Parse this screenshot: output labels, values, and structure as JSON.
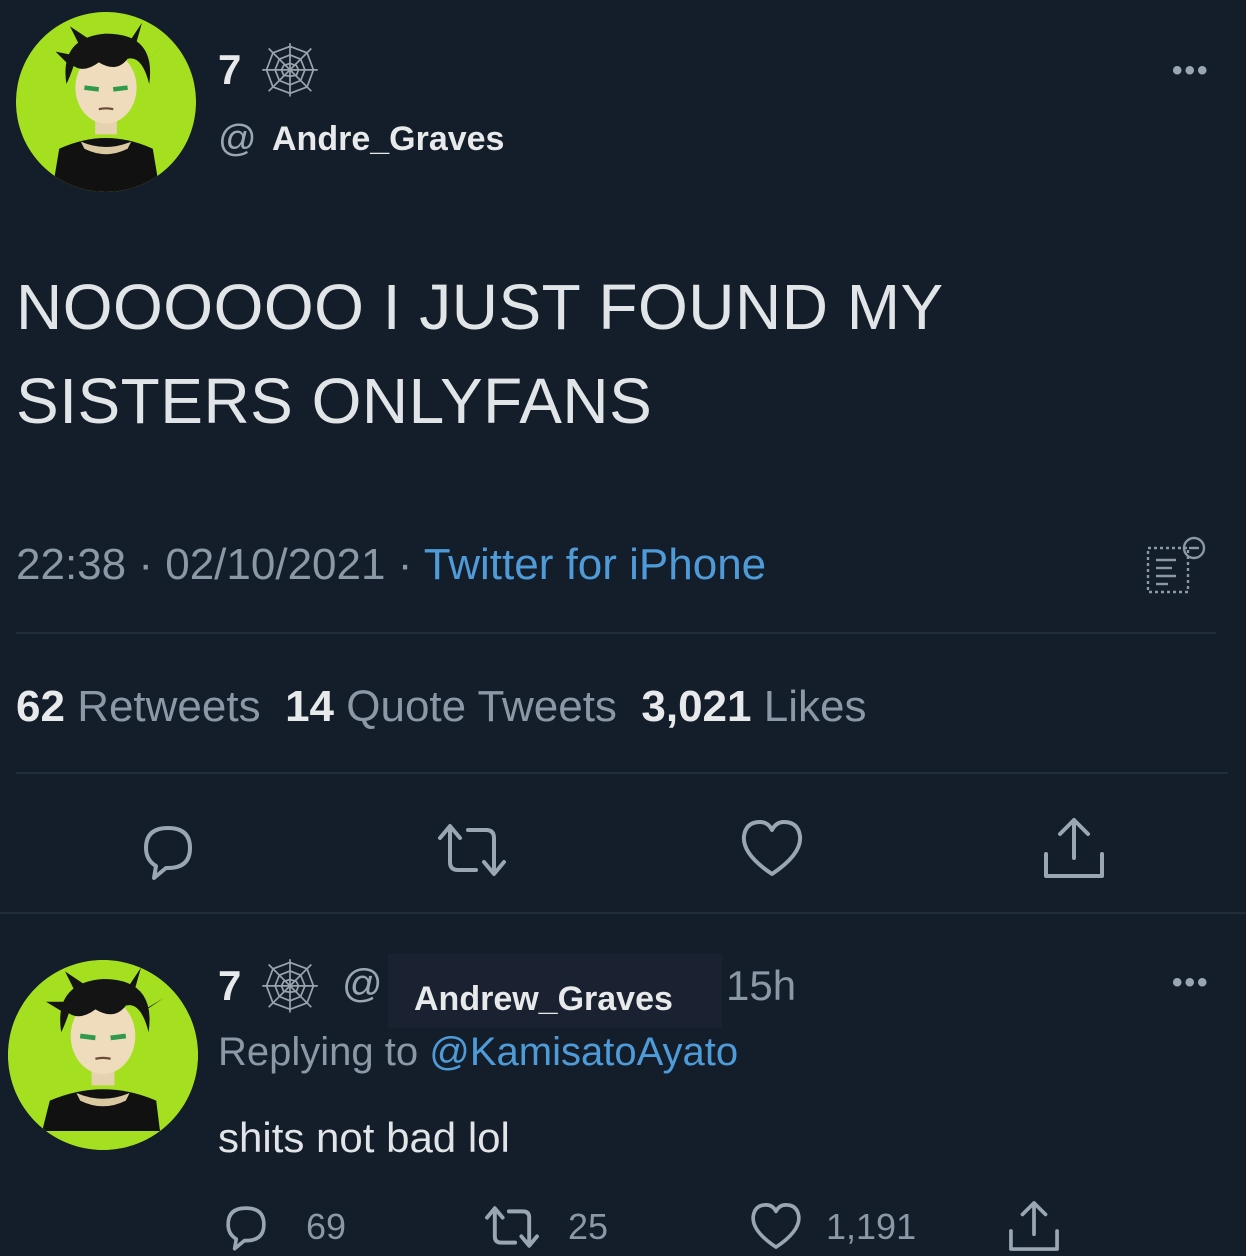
{
  "tweet": {
    "display_name": "7",
    "at_symbol": "@",
    "handle": "Andre_Graves",
    "more": "•••",
    "text_line1": "NOOOOOO I JUST FOUND MY",
    "text_line2": "SISTERS ONLYFANS",
    "time": "22:38",
    "sep1": "·",
    "date": "02/10/2021",
    "sep2": "·",
    "source": "Twitter for iPhone",
    "retweets_count": "62",
    "retweets_label": "Retweets",
    "quotes_count": "14",
    "quotes_label": "Quote Tweets",
    "likes_count": "3,021",
    "likes_label": "Likes"
  },
  "reply": {
    "display_name": "7",
    "at_symbol": "@",
    "handle": "Andrew_Graves",
    "time": "15h",
    "more": "•••",
    "replying_label": "Replying to",
    "replying_mention": "@KamisatoAyato",
    "text": "shits not bad lol",
    "reply_count": "69",
    "retweet_count": "25",
    "like_count": "1,191"
  },
  "icons": [
    "spiderweb-icon",
    "analytics-icon",
    "reply-icon",
    "retweet-icon",
    "like-icon",
    "share-icon"
  ],
  "colors": {
    "background": "#141d2a",
    "avatar_bg": "#a4e01f",
    "link": "#4e9bd8",
    "muted": "#8b98a5",
    "text": "#e7e9ea"
  }
}
